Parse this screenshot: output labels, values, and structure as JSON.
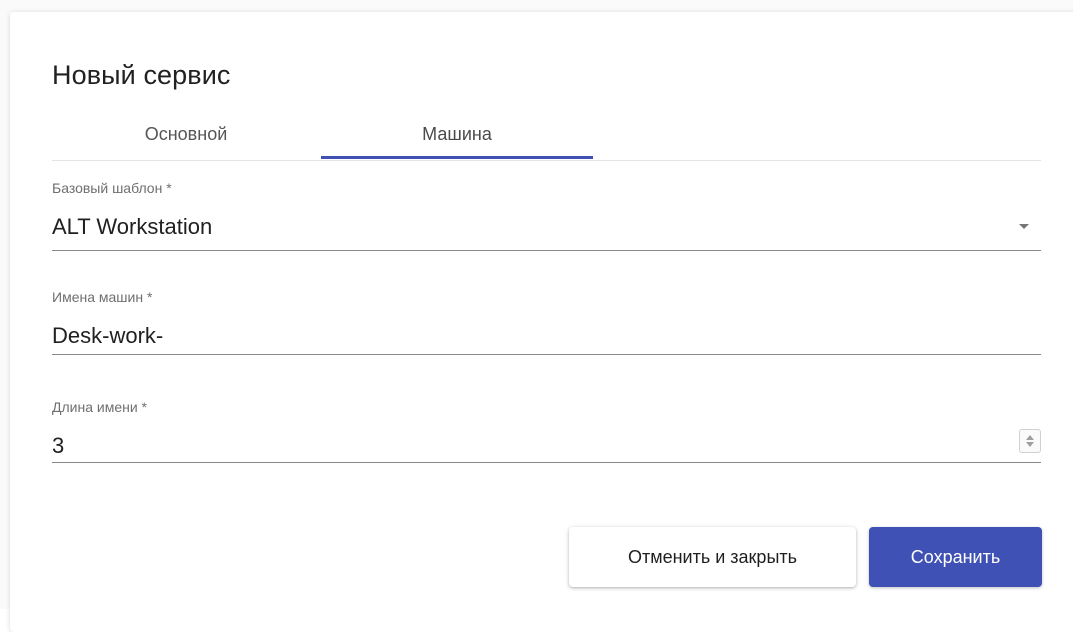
{
  "dialog": {
    "title": "Новый сервис"
  },
  "tabs": [
    {
      "label": "Основной",
      "active": false
    },
    {
      "label": "Машина",
      "active": true
    }
  ],
  "form": {
    "base_template": {
      "label": "Базовый шаблон *",
      "value": "ALT Workstation"
    },
    "machine_names": {
      "label": "Имена машин *",
      "value": "Desk-work-"
    },
    "name_length": {
      "label": "Длина имени *",
      "value": "3"
    }
  },
  "actions": {
    "cancel_label": "Отменить и закрыть",
    "save_label": "Сохранить"
  },
  "colors": {
    "accent": "#3f51b5",
    "text": "#212121",
    "label": "#6f6f6f"
  }
}
